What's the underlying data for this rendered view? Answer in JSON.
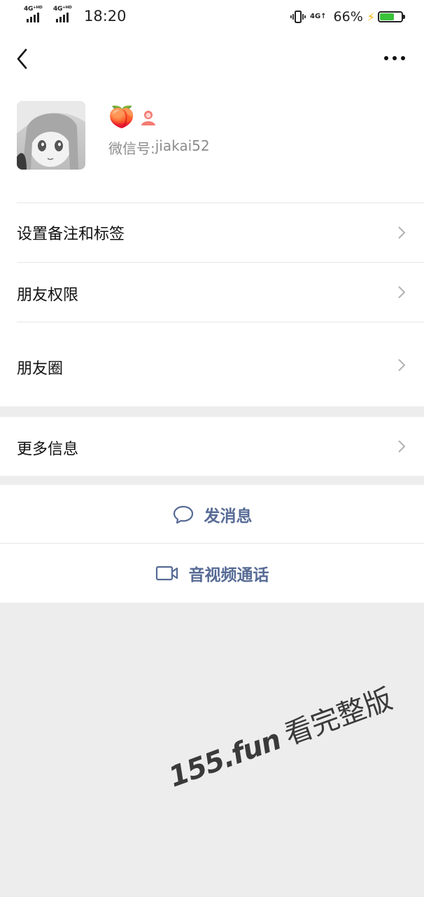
{
  "status_bar": {
    "signal1_label": "4G⁺ᴴᴰ",
    "signal2_label": "4G⁺ᴴᴰ",
    "time": "18:20",
    "network": "4G↑",
    "battery_percent_text": "66%",
    "battery_level": 0.66,
    "battery_color": "#3bc23b"
  },
  "nav": {
    "back_icon": "chevron-left-icon",
    "more_icon": "more-dots-icon"
  },
  "profile": {
    "name": "🍑",
    "gender_icon": "female-user-icon",
    "gender_color": "#f37b73",
    "wechat_id_label": "微信号:",
    "wechat_id_value": "jiakai52"
  },
  "menu": [
    {
      "label": "设置备注和标签"
    },
    {
      "label": "朋友权限"
    },
    {
      "label": "朋友圈"
    },
    {
      "label": "更多信息"
    }
  ],
  "actions": {
    "message_label": "发消息",
    "message_icon": "chat-bubble-icon",
    "video_label": "音视频通话",
    "video_icon": "video-camera-icon",
    "link_color": "#576b95"
  },
  "watermark": {
    "part1": "155.fun",
    "part2": "看完整版"
  }
}
